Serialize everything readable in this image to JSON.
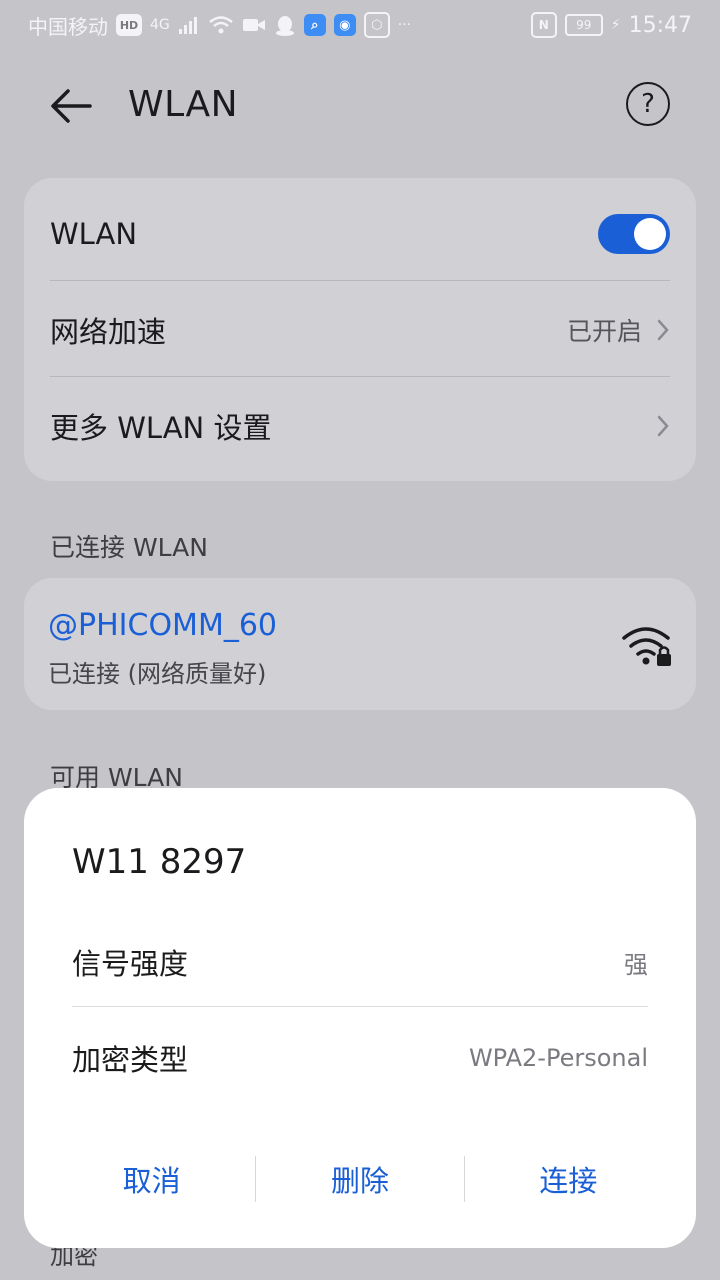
{
  "status_bar": {
    "carrier": "中国移动",
    "hd_badge": "HD",
    "network_type": "4G",
    "time": "15:47",
    "battery": "99",
    "more": "···"
  },
  "header": {
    "title": "WLAN",
    "help": "?"
  },
  "settings": {
    "wlan_label": "WLAN",
    "wlan_enabled": true,
    "accel_label": "网络加速",
    "accel_value": "已开启",
    "more_label": "更多 WLAN 设置"
  },
  "connected": {
    "section_label": "已连接 WLAN",
    "ssid": "@PHICOMM_60",
    "status": "已连接 (网络质量好)"
  },
  "available": {
    "section_label": "可用 WLAN",
    "partial_item": "加密"
  },
  "dialog": {
    "title": "W11 8297",
    "signal_label": "信号强度",
    "signal_value": "强",
    "security_label": "加密类型",
    "security_value": "WPA2-Personal",
    "cancel": "取消",
    "delete": "删除",
    "connect": "连接"
  },
  "colors": {
    "accent": "#1a5fd6",
    "background": "#c5c5c9",
    "card": "#d0d0d5"
  }
}
